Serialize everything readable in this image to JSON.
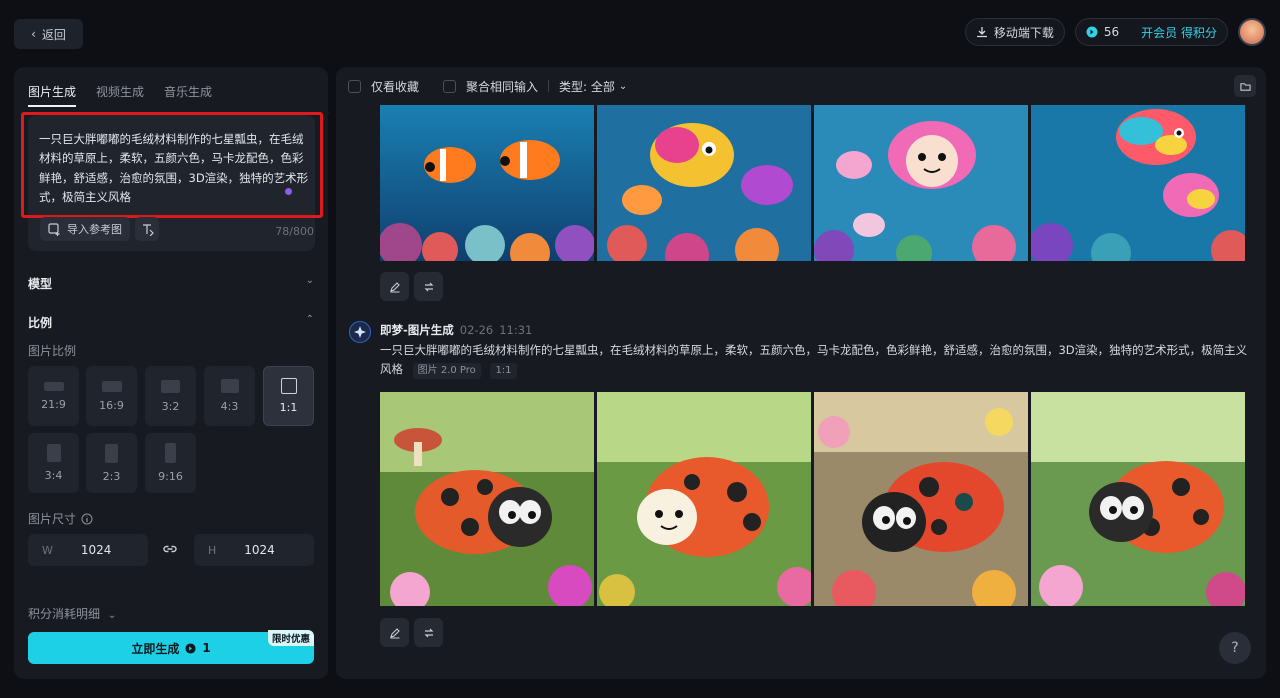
{
  "topbar": {
    "back_label": "返回",
    "download_label": "移动端下载",
    "credits": "56",
    "vip_label": "开会员 得积分"
  },
  "left": {
    "tabs": [
      "图片生成",
      "视频生成",
      "音乐生成"
    ],
    "prompt": "一只巨大胖嘟嘟的毛绒材料制作的七星瓢虫，在毛绒材料的草原上，柔软，五颜六色，马卡龙配色，色彩鲜艳，舒适感，治愈的氛围，3D渲染，独特的艺术形式，极简主义风格",
    "ref_label": "导入参考图",
    "counter": "78/800",
    "model_label": "模型",
    "ratio_label": "比例",
    "ratio_sub": "图片比例",
    "ratios": [
      "21:9",
      "16:9",
      "3:2",
      "4:3",
      "1:1",
      "3:4",
      "2:3",
      "9:16"
    ],
    "selected_ratio": "1:1",
    "size_label": "图片尺寸",
    "width_key": "W",
    "width": "1024",
    "height_key": "H",
    "height": "1024",
    "consume_label": "积分消耗明细",
    "gen_label": "立即生成",
    "gen_cost": "1",
    "promo": "限时优惠"
  },
  "right": {
    "filter_fav": "仅看收藏",
    "filter_merge": "聚合相同输入",
    "filter_type": "类型: 全部",
    "msg_name": "即梦-图片生成",
    "msg_date": "02-26",
    "msg_time": "11:31",
    "msg_text": "一只巨大胖嘟嘟的毛绒材料制作的七星瓢虫，在毛绒材料的草原上，柔软，五颜六色，马卡龙配色，色彩鲜艳，舒适感，治愈的氛围，3D渲染，独特的艺术形式，极简主义风格",
    "msg_model": "图片 2.0 Pro",
    "msg_ratio": "1:1"
  },
  "help_label": "?"
}
